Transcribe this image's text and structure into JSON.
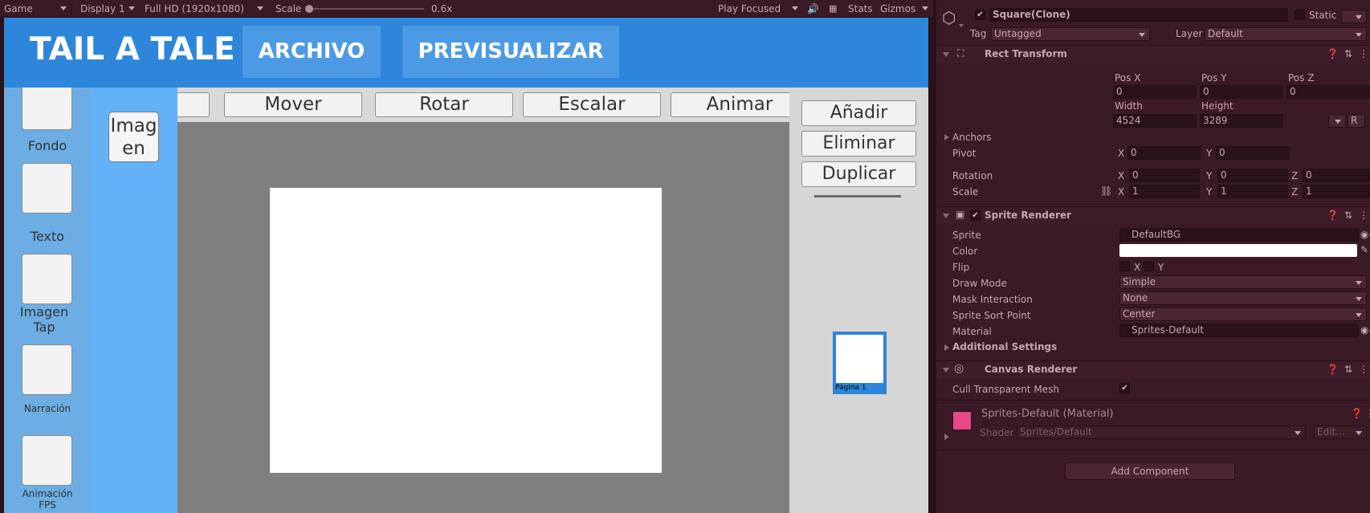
{
  "toolbar": {
    "game": "Game",
    "display": "Display 1",
    "resolution": "Full HD (1920x1080)",
    "scale_label": "Scale",
    "scale_value": "0.6x",
    "play": "Play Focused",
    "stats": "Stats",
    "gizmos": "Gizmos"
  },
  "app": {
    "brand": "TAIL A TALE",
    "menu": [
      "ARCHIVO",
      "PREVISUALIZAR"
    ],
    "left": [
      "Fondo",
      "Texto",
      "Imagen Tap",
      "Narración",
      "Animación FPS"
    ],
    "middle_button": "Imagen",
    "tools": [
      "Mover",
      "Rotar",
      "Escalar",
      "Animar"
    ],
    "page_actions": [
      "Añadir",
      "Eliminar",
      "Duplicar"
    ],
    "thumb_label": "Página 1"
  },
  "inspector": {
    "name": "Square(Clone)",
    "static": "Static",
    "tag_label": "Tag",
    "tag": "Untagged",
    "layer_label": "Layer",
    "layer": "Default",
    "rect": {
      "title": "Rect Transform",
      "posx_l": "Pos X",
      "posy_l": "Pos Y",
      "posz_l": "Pos Z",
      "posx": "0",
      "posy": "0",
      "posz": "0",
      "w_l": "Width",
      "h_l": "Height",
      "w": "4524",
      "h": "3289",
      "r": "R",
      "anchors": "Anchors",
      "pivot": "Pivot",
      "pivot_x": "0",
      "pivot_y": "0",
      "rotation": "Rotation",
      "rot_x": "0",
      "rot_y": "0",
      "rot_z": "0",
      "scale": "Scale",
      "sc_x": "1",
      "sc_y": "1",
      "sc_z": "1",
      "x": "X",
      "y": "Y",
      "z": "Z"
    },
    "sprite": {
      "title": "Sprite Renderer",
      "sprite_l": "Sprite",
      "sprite": "DefaultBG",
      "color_l": "Color",
      "color": "#ffffff",
      "flip_l": "Flip",
      "flip_x": "X",
      "flip_y": "Y",
      "draw_l": "Draw Mode",
      "draw": "Simple",
      "mask_l": "Mask Interaction",
      "mask": "None",
      "sort_l": "Sprite Sort Point",
      "sort": "Center",
      "mat_l": "Material",
      "mat": "Sprites-Default",
      "additional": "Additional Settings"
    },
    "canvas": {
      "title": "Canvas Renderer",
      "cull": "Cull Transparent Mesh"
    },
    "material": {
      "title": "Sprites-Default (Material)",
      "shader_l": "Shader",
      "shader": "Sprites/Default",
      "edit": "Edit...",
      "color": "#e8488a"
    },
    "add": "Add Component"
  }
}
